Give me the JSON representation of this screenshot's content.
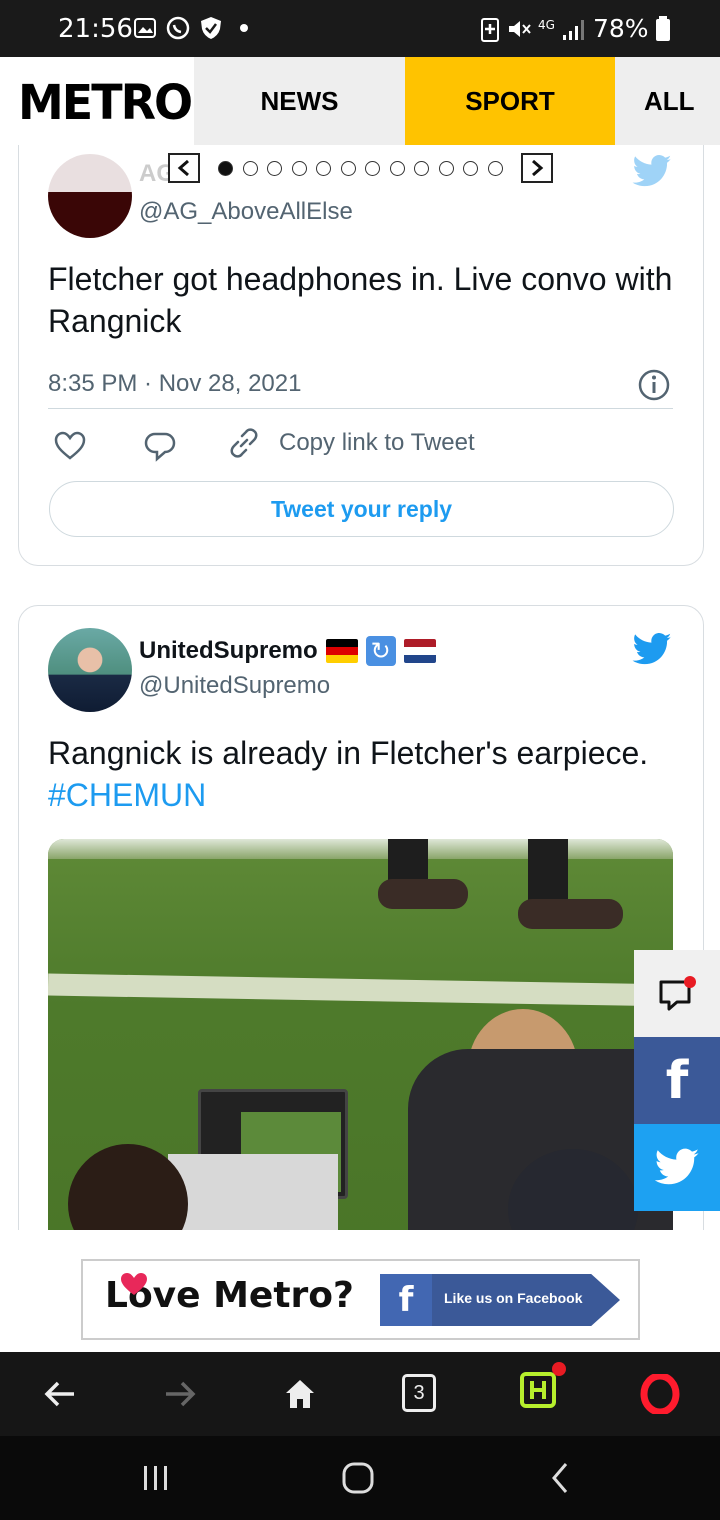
{
  "status_bar": {
    "time": "21:56",
    "network": "4G",
    "battery": "78%"
  },
  "nav": {
    "logo": "METRO",
    "tabs": [
      "NEWS",
      "SPORT",
      "ALL"
    ],
    "active_tab": "SPORT"
  },
  "tweet1": {
    "handle": "@AG_AboveAllElse",
    "name_partial": "AG",
    "text": "Fletcher got headphones in. Live convo with Rangnick",
    "time": "8:35 PM · Nov 28, 2021",
    "copy_link": "Copy link to Tweet",
    "reply_label": "Tweet your reply"
  },
  "carousel": {
    "dot_count": 12,
    "active_index": 0
  },
  "tweet2": {
    "name": "UnitedSupremo",
    "handle": "@UnitedSupremo",
    "text": "Rangnick is already in Fletcher's earpiece.",
    "hashtag": "#CHEMUN"
  },
  "banner": {
    "title": "Love Metro?",
    "fb_label": "Like us on Facebook",
    "fb_letter": "f"
  },
  "bottom_nav": {
    "tab_count": "3"
  },
  "colors": {
    "twitter_blue": "#1d9bf0",
    "sport_yellow": "#ffc300",
    "facebook_blue": "#3b5998",
    "share_twitter": "#1da1f2"
  }
}
